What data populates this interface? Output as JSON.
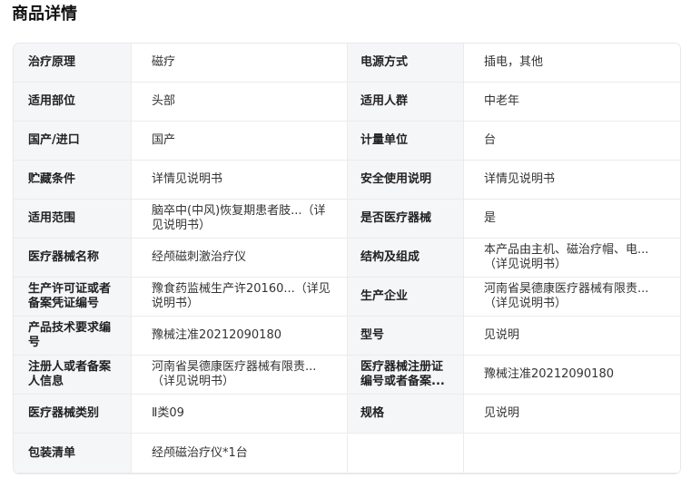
{
  "header": {
    "title": "商品详情"
  },
  "rows": [
    [
      {
        "label": [
          "治疗原理"
        ],
        "value": [
          "磁疗"
        ]
      },
      {
        "label": [
          "电源方式"
        ],
        "value": [
          "插电，其他"
        ]
      }
    ],
    [
      {
        "label": [
          "适用部位"
        ],
        "value": [
          "头部"
        ]
      },
      {
        "label": [
          "适用人群"
        ],
        "value": [
          "中老年"
        ]
      }
    ],
    [
      {
        "label": [
          "国产/进口"
        ],
        "value": [
          "国产"
        ]
      },
      {
        "label": [
          "计量单位"
        ],
        "value": [
          "台"
        ]
      }
    ],
    [
      {
        "label": [
          "贮藏条件"
        ],
        "value": [
          "详情见说明书"
        ]
      },
      {
        "label": [
          "安全使用说明"
        ],
        "value": [
          "详情见说明书"
        ]
      }
    ],
    [
      {
        "label": [
          "适用范围"
        ],
        "value": [
          "脑卒中(中风)恢复期患者肢...（详",
          "见说明书）"
        ]
      },
      {
        "label": [
          "是否医疗器械"
        ],
        "value": [
          "是"
        ]
      }
    ],
    [
      {
        "label": [
          "医疗器械名称"
        ],
        "value": [
          "经颅磁刺激治疗仪"
        ]
      },
      {
        "label": [
          "结构及组成"
        ],
        "value": [
          "本产品由主机、磁治疗帽、电...",
          "（详见说明书）"
        ]
      }
    ],
    [
      {
        "label": [
          "生产许可证或者",
          "备案凭证编号"
        ],
        "value": [
          "豫食药监械生产许20160...（详见",
          "说明书）"
        ]
      },
      {
        "label": [
          "生产企业"
        ],
        "value": [
          "河南省昊德康医疗器械有限责...",
          "（详见说明书）"
        ]
      }
    ],
    [
      {
        "label": [
          "产品技术要求编",
          "号"
        ],
        "value": [
          "豫械注准20212090180"
        ]
      },
      {
        "label": [
          "型号"
        ],
        "value": [
          "见说明"
        ]
      }
    ],
    [
      {
        "label": [
          "注册人或者备案",
          "人信息"
        ],
        "value": [
          "河南省昊德康医疗器械有限责...",
          "（详见说明书）"
        ]
      },
      {
        "label": [
          "医疗器械注册证",
          "编号或者备案..."
        ],
        "value": [
          "豫械注准20212090180"
        ]
      }
    ],
    [
      {
        "label": [
          "医疗器械类别"
        ],
        "value": [
          "Ⅱ类09"
        ]
      },
      {
        "label": [
          "规格"
        ],
        "value": [
          "见说明"
        ]
      }
    ]
  ],
  "last_row": {
    "label": [
      "包装清单"
    ],
    "value": [
      "经颅磁治疗仪*1台"
    ]
  }
}
